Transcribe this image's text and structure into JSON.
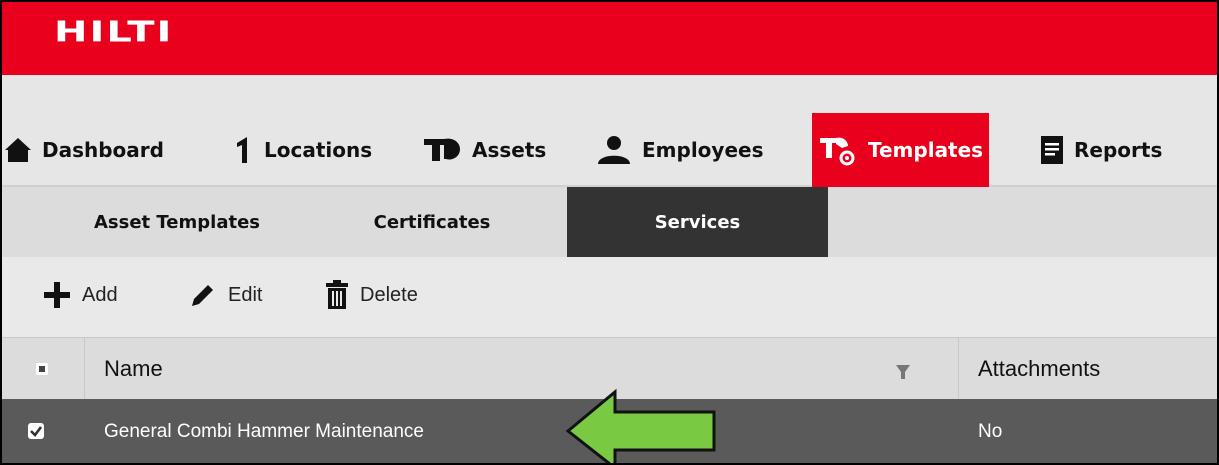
{
  "brand": {
    "logo_text": "HILTI",
    "color": "#e8001c"
  },
  "nav": {
    "items": [
      {
        "label": "Dashboard",
        "icon": "home-icon"
      },
      {
        "label": "Locations",
        "icon": "location-pin-icon"
      },
      {
        "label": "Assets",
        "icon": "tool-icon"
      },
      {
        "label": "Employees",
        "icon": "person-icon"
      },
      {
        "label": "Templates",
        "icon": "templates-icon",
        "active": true
      },
      {
        "label": "Reports",
        "icon": "report-icon"
      }
    ]
  },
  "subnav": {
    "tabs": [
      {
        "label": "Asset Templates"
      },
      {
        "label": "Certificates"
      },
      {
        "label": "Services",
        "active": true
      }
    ]
  },
  "toolbar": {
    "add_label": "Add",
    "edit_label": "Edit",
    "delete_label": "Delete"
  },
  "grid": {
    "columns": [
      {
        "label": "Name"
      },
      {
        "label": "Attachments"
      }
    ],
    "rows": [
      {
        "name": "General Combi Hammer Maintenance",
        "attachments": "No",
        "checked": true,
        "selected": true
      }
    ]
  },
  "annotation": {
    "arrow_color": "#7ac943",
    "icon": "arrow-left-icon"
  }
}
